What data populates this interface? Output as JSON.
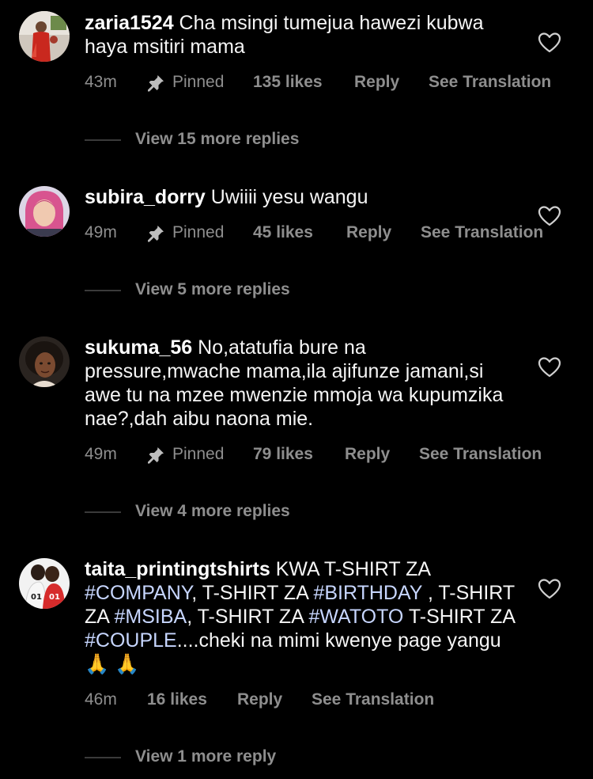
{
  "comments": [
    {
      "username": "zaria1524",
      "text": " Cha msingi tumejua hawezi kubwa haya msitiri mama",
      "time": "43m",
      "pinned_label": "Pinned",
      "likes": "135 likes",
      "reply_label": "Reply",
      "translation_label": "See Translation",
      "view_replies": "View 15 more replies",
      "avatar_icon": "user-photo-red-dress"
    },
    {
      "username": "subira_dorry",
      "text": " Uwiiii yesu wangu",
      "time": "49m",
      "pinned_label": "Pinned",
      "likes": "45 likes",
      "reply_label": "Reply",
      "translation_label": "See Translation",
      "view_replies": "View 5 more replies",
      "avatar_icon": "user-photo-pink-hair"
    },
    {
      "username": "sukuma_56",
      "text": " No,atatufia bure na pressure,mwache mama,ila ajifunze jamani,si awe tu na mzee mwenzie mmoja wa kupumzika nae?,dah aibu naona mie.",
      "time": "49m",
      "pinned_label": "Pinned",
      "likes": "79 likes",
      "reply_label": "Reply",
      "translation_label": "See Translation",
      "view_replies": "View 4 more replies",
      "avatar_icon": "user-photo-woman"
    },
    {
      "username": "taita_printingtshirts",
      "text_parts": [
        " KWA T-SHIRT ZA ",
        "#COMPANY",
        ", T-SHIRT ZA ",
        "#BIRTHDAY",
        " , T-SHIRT ZA ",
        "#MSIBA",
        ",  T-SHIRT ZA ",
        "#WATOTO",
        " T-SHIRT ZA ",
        "#COUPLE",
        "....cheki na mimi kwenye page yangu "
      ],
      "emoji": "🙏 🙏",
      "time": "46m",
      "likes": "16 likes",
      "reply_label": "Reply",
      "translation_label": "See Translation",
      "view_replies": "View 1 more reply",
      "avatar_icon": "user-photo-couple-shirts"
    }
  ],
  "icons": {
    "pin": "pin-icon",
    "heart": "heart-outline-icon"
  },
  "colors": {
    "background": "#000000",
    "text": "#ffffff",
    "muted": "#8e8e8e",
    "hashtag": "#c7d6ff"
  }
}
